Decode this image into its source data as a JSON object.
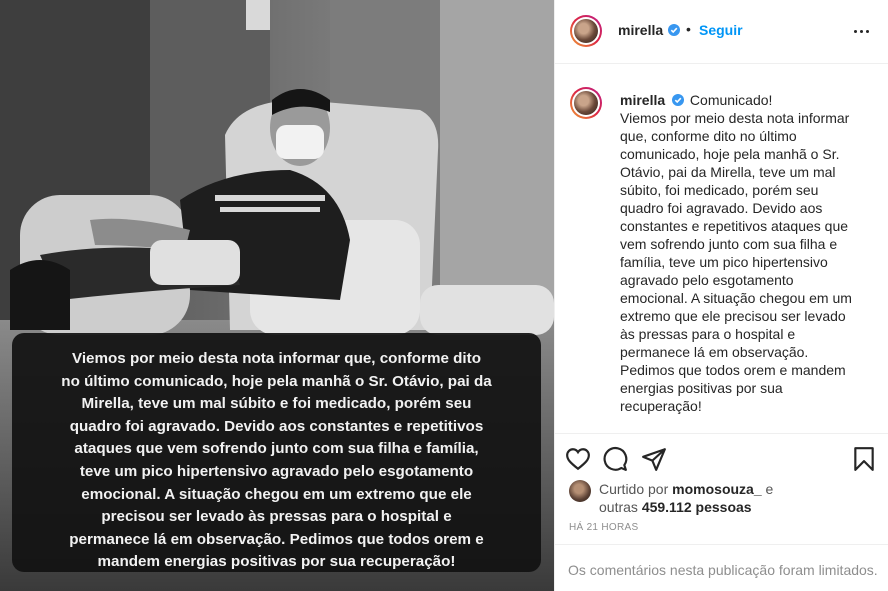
{
  "post": {
    "username": "mirella",
    "follow_label": "Seguir",
    "dot": "•",
    "verified_icon": "verified-badge-icon",
    "more_icon": "more-options-icon"
  },
  "media": {
    "caption_lines": [
      "Viemos por meio desta nota informar que, conforme dito",
      "no último comunicado, hoje pela manhã o Sr. Otávio, pai da",
      "Mirella, teve um mal súbito e foi medicado, porém seu",
      "quadro foi agravado. Devido aos constantes e repetitivos",
      "ataques que vem sofrendo junto com sua filha e família,",
      "teve um pico hipertensivo agravado pelo esgotamento",
      "emocional. A situação chegou em um extremo que ele",
      "precisou ser levado às pressas para o hospital e",
      "permanece lá em observação. Pedimos que todos orem e",
      "mandem energias positivas por sua recuperação!"
    ]
  },
  "comment": {
    "username": "mirella",
    "first_line_text": "Comunicado!",
    "body_lines": [
      "Viemos por meio desta nota informar",
      "que, conforme dito no último",
      "comunicado, hoje pela manhã o Sr.",
      "Otávio, pai da Mirella, teve um mal",
      "súbito, foi medicado, porém seu",
      "quadro foi agravado. Devido aos",
      "constantes e repetitivos ataques que",
      "vem sofrendo junto com sua filha e",
      "família, teve um pico hipertensivo",
      "agravado pelo esgotamento",
      "emocional. A situação chegou em um",
      "extremo que ele precisou ser levado",
      "às pressas para o hospital e",
      "permanece lá em observação.",
      "Pedimos que todos orem e mandem",
      "energias positivas por sua",
      "recuperação!"
    ]
  },
  "actions": {
    "like_icon": "heart-icon",
    "comment_icon": "comment-bubble-icon",
    "share_icon": "paper-plane-icon",
    "save_icon": "bookmark-icon"
  },
  "likes": {
    "prefix": "Curtido por",
    "liker": "momosouza_",
    "and": "e",
    "others_prefix": "outras",
    "others_count": "459.112 pessoas"
  },
  "timestamp": "HÁ 21 HORAS",
  "comments_limited": "Os comentários nesta publicação foram limitados.",
  "colors": {
    "accent": "#0095f6",
    "verified": "#3897f0",
    "text": "#262626",
    "muted": "#8e8e8e"
  }
}
